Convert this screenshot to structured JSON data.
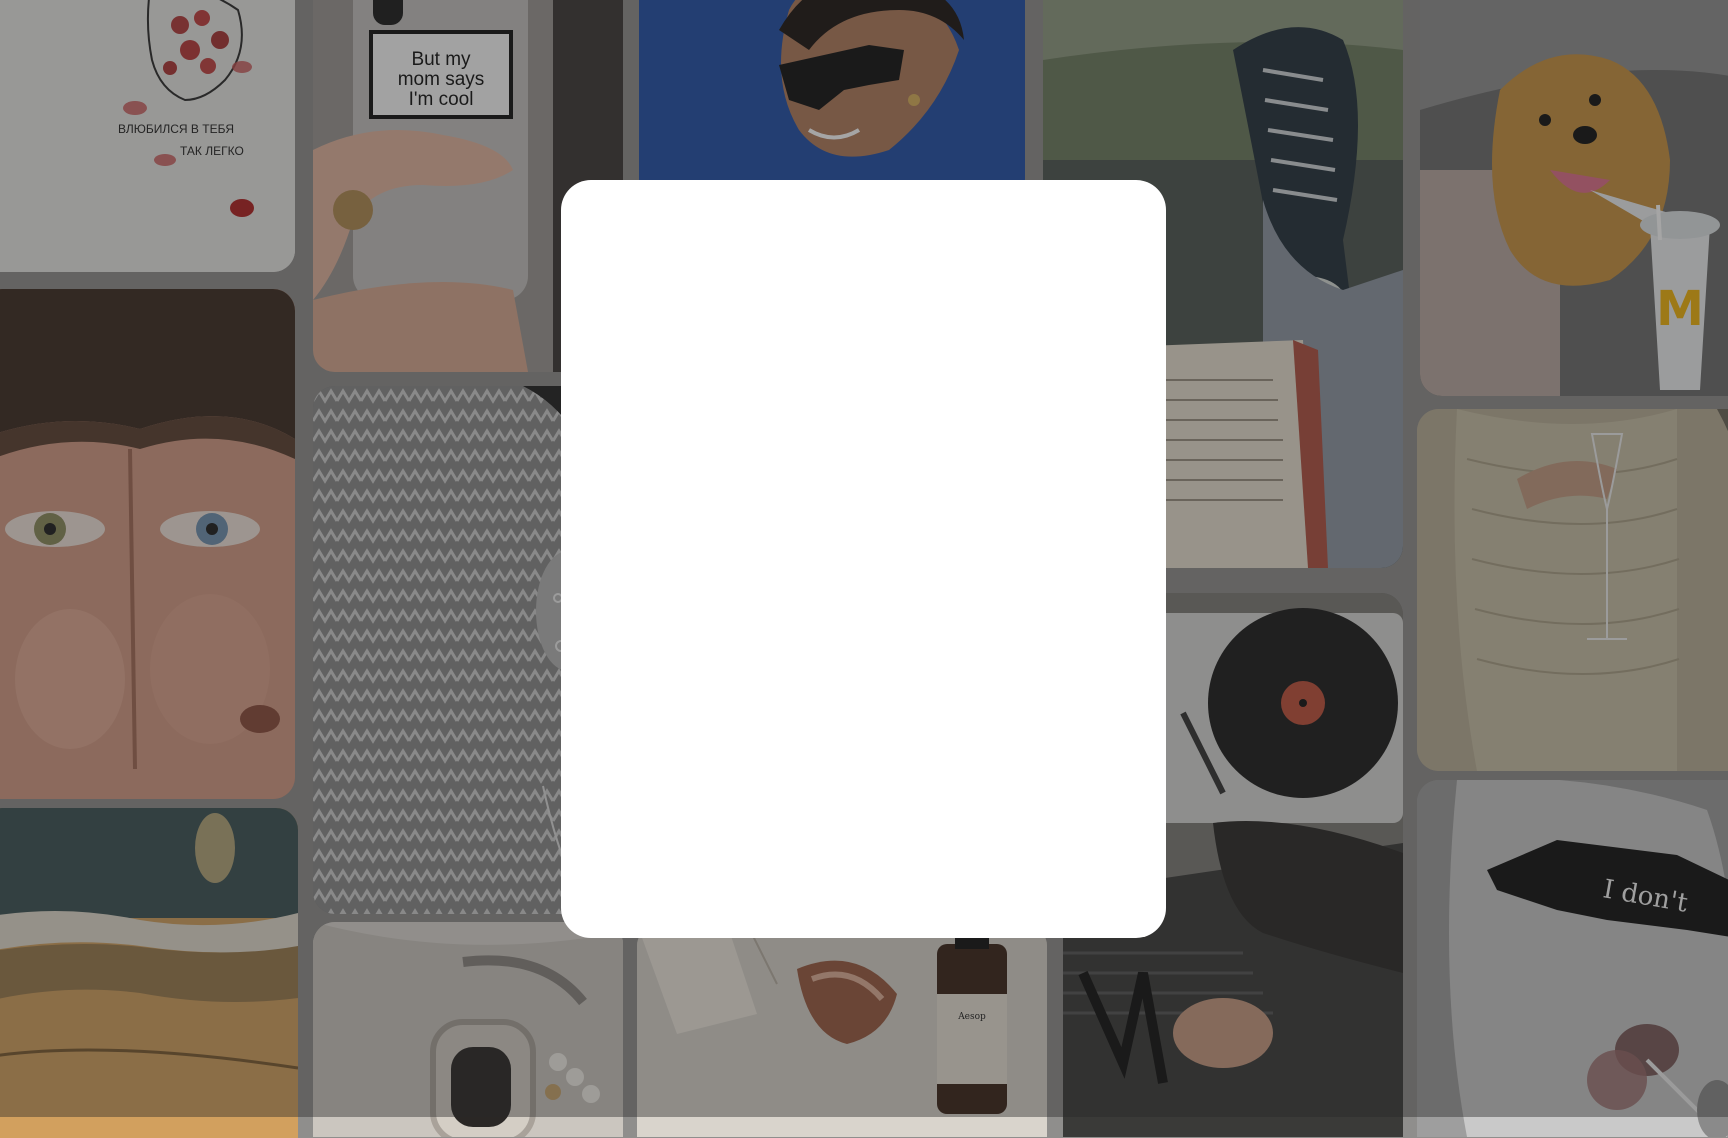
{
  "gallery": {
    "shirt_text_line1": "ВЛЮБИЛСЯ В ТЕБЯ",
    "shirt_text_line2": "ТАК ЛЕГКО",
    "phone_case_line1": "But my",
    "phone_case_line2": "mom says",
    "phone_case_line3": "I'm cool",
    "sunglasses_text": "I don't",
    "bottle_label": "Aesop",
    "cup_logo": "M"
  },
  "colors": {
    "backdrop": "#8f8e8c",
    "overlay": "rgba(40,40,40,0.42)",
    "modal_bg": "#ffffff",
    "sky": "#1f4fa8",
    "cup_logo": "#f2b30b"
  }
}
